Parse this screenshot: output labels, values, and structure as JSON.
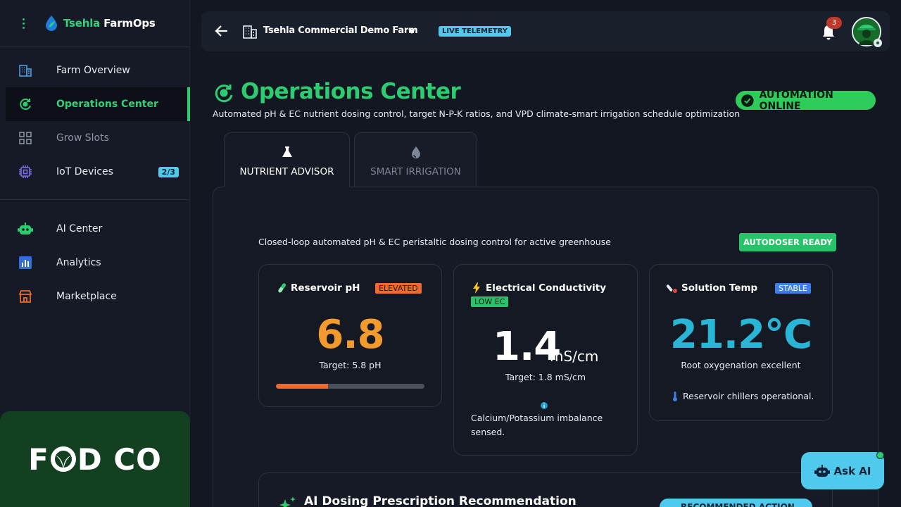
{
  "brand": {
    "name_part1": "Tsehla",
    "name_part2": " FarmOps"
  },
  "sidebar": {
    "items": [
      {
        "label": "Farm Overview"
      },
      {
        "label": "Operations Center"
      },
      {
        "label": "Grow Slots"
      },
      {
        "label": "IoT Devices",
        "badge": "2/3"
      },
      {
        "label": "AI Center"
      },
      {
        "label": "Analytics"
      },
      {
        "label": "Marketplace"
      }
    ],
    "banner_text_1": "F",
    "banner_text_2": "D CO"
  },
  "topbar": {
    "farm_name": "Tsehla Commercial Demo Farm",
    "live_badge": "LIVE TELEMETRY",
    "notification_count": "3"
  },
  "header": {
    "title": "Operations Center",
    "subtitle": "Automated pH & EC nutrient dosing control, target N-P-K ratios, and VPD climate-smart irrigation schedule optimization",
    "status_badge": "AUTOMATION ONLINE"
  },
  "tabs": [
    {
      "label": "NUTRIENT ADVISOR"
    },
    {
      "label": "SMART IRRIGATION"
    }
  ],
  "panel": {
    "description": "Closed-loop automated pH & EC peristaltic dosing control for active greenhouse",
    "ready_badge": "AUTODOSER READY"
  },
  "cards": {
    "ph": {
      "title": "Reservoir pH",
      "badge": "ELEVATED",
      "value": "6.8",
      "target": "Target: 5.8 pH",
      "progress": 0.35
    },
    "ec": {
      "title": "Electrical Conductivity",
      "badge": "LOW EC",
      "value": "1.4",
      "unit": "mS/cm",
      "target": "Target: 1.8 mS/cm",
      "note": "Calcium/Potassium imbalance sensed."
    },
    "temp": {
      "title": "Solution Temp",
      "badge": "STABLE",
      "value": "21.2°C",
      "note1": "Root oxygenation excellent",
      "note2": "Reservoir chillers operational."
    }
  },
  "prescription": {
    "title": "AI Dosing Prescription Recommendation",
    "badge": "RECOMMENDED ACTION"
  },
  "ask_ai": {
    "label": "Ask AI"
  },
  "colors": {
    "accent_green": "#2ecc71",
    "accent_cyan": "#4fc9ec",
    "warning_orange": "#ee6a2d",
    "ph_value": "#f29a2e",
    "temp_value": "#29b6d6"
  }
}
